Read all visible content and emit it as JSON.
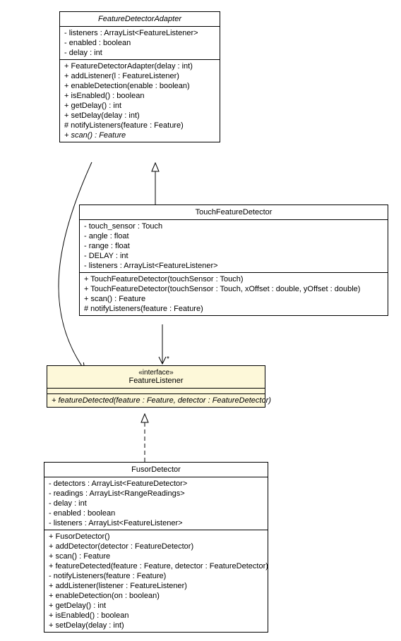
{
  "chart_data": {
    "type": "uml-class-diagram",
    "classes": [
      {
        "id": "FeatureDetectorAdapter",
        "name": "FeatureDetectorAdapter",
        "abstract": true,
        "attributes": [
          "- listeners : ArrayList<FeatureListener>",
          "- enabled : boolean",
          "- delay : int"
        ],
        "operations": [
          "+ FeatureDetectorAdapter(delay : int)",
          "+ addListener(l : FeatureListener)",
          "+ enableDetection(enable : boolean)",
          "+ isEnabled() : boolean",
          "+ getDelay() : int",
          "+ setDelay(delay : int)",
          "# notifyListeners(feature : Feature)",
          "+ scan() : Feature"
        ],
        "operationStyles": [
          null,
          null,
          null,
          null,
          null,
          null,
          null,
          "italic"
        ]
      },
      {
        "id": "TouchFeatureDetector",
        "name": "TouchFeatureDetector",
        "attributes": [
          "- touch_sensor : Touch",
          "- angle : float",
          "- range : float",
          "- DELAY : int",
          "- listeners : ArrayList<FeatureListener>"
        ],
        "operations": [
          "+ TouchFeatureDetector(touchSensor : Touch)",
          "+ TouchFeatureDetector(touchSensor : Touch, xOffset : double, yOffset : double)",
          "+ scan() : Feature",
          "# notifyListeners(feature : Feature)"
        ]
      },
      {
        "id": "FeatureListener",
        "name": "FeatureListener",
        "stereotype": "«interface»",
        "interface": true,
        "attributes": [],
        "operations": [
          "+ featureDetected(feature : Feature, detector : FeatureDetector)"
        ],
        "operationStyles": [
          "italic"
        ]
      },
      {
        "id": "FusorDetector",
        "name": "FusorDetector",
        "attributes": [
          "- detectors : ArrayList<FeatureDetector>",
          "- readings : ArrayList<RangeReadings>",
          "- delay : int",
          "- enabled : boolean",
          "- listeners : ArrayList<FeatureListener>"
        ],
        "operations": [
          "+ FusorDetector()",
          "+ addDetector(detector : FeatureDetector)",
          "+ scan() : Feature",
          "+ featureDetected(feature : Feature, detector : FeatureDetector)",
          "- notifyListeners(feature : Feature)",
          "+ addListener(listener : FeatureListener)",
          "+ enableDetection(on : boolean)",
          "+ getDelay() : int",
          "+ isEnabled() : boolean",
          "+ setDelay(delay : int)"
        ]
      }
    ],
    "relationships": [
      {
        "from": "TouchFeatureDetector",
        "to": "FeatureDetectorAdapter",
        "type": "generalization"
      },
      {
        "from": "FusorDetector",
        "to": "FeatureListener",
        "type": "realization"
      },
      {
        "from": "FeatureDetectorAdapter",
        "to": "FeatureListener",
        "type": "association",
        "multiplicity": "*"
      },
      {
        "from": "TouchFeatureDetector",
        "to": "FeatureListener",
        "type": "association",
        "multiplicity": "*"
      }
    ]
  },
  "multiplicity_star": "*"
}
